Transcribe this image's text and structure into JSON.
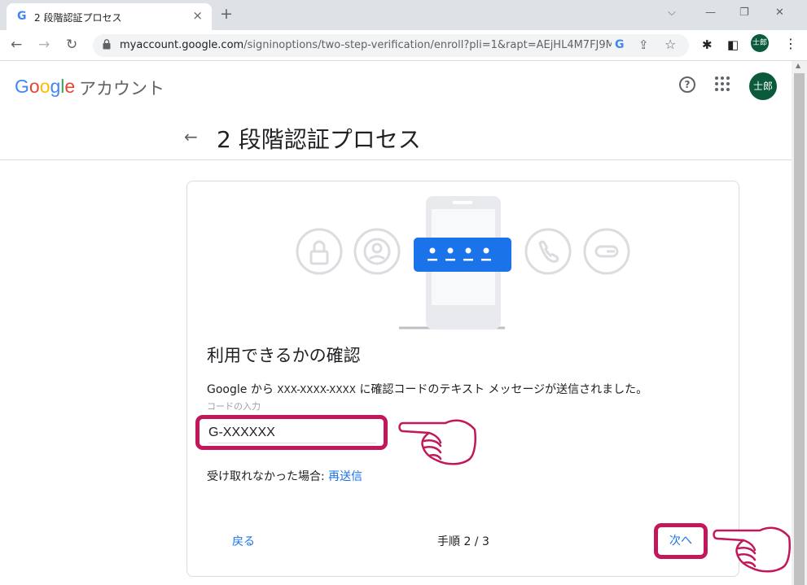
{
  "browser": {
    "tab_title": "2 段階認証プロセス",
    "url_host": "myaccount.google.com",
    "url_path": "/signinoptions/two-step-verification/enroll?pli=1&rapt=AEjHL4M7FJ9M",
    "profile_initials": "士郎"
  },
  "header": {
    "logo_text": "Google",
    "product_name": "アカウント",
    "avatar_initials": "士郎"
  },
  "page": {
    "title": "2 段階認証プロセス"
  },
  "card": {
    "heading": "利用できるかの確認",
    "message_prefix": "Google から",
    "phone_number": "XXX-XXXX-XXXX",
    "message_suffix": "に確認コードのテキスト メッセージが送信されました。",
    "code_field_label": "コードの入力",
    "code_value": "G-XXXXXX",
    "not_received": "受け取れなかった場合:",
    "resend_link": "再送信",
    "back_button": "戻る",
    "step_indicator": "手順 2 / 3",
    "next_button": "次へ"
  },
  "colors": {
    "accent": "#1a73e8",
    "highlight": "#c2185b",
    "avatar": "#0b5a3b"
  }
}
